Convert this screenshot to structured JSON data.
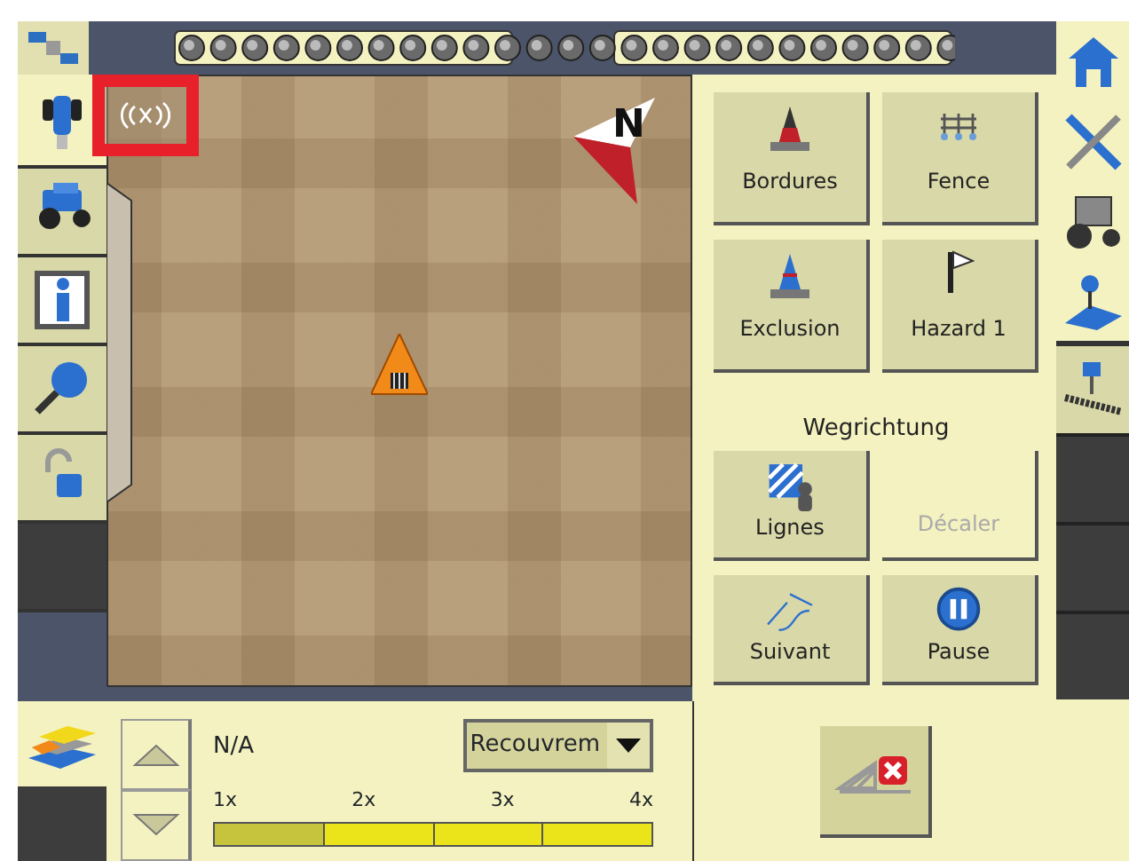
{
  "left_tabs": [
    {
      "kind": "tractor-front",
      "selected": true
    },
    {
      "kind": "tractor",
      "selected": false
    },
    {
      "kind": "info",
      "selected": false
    },
    {
      "kind": "search",
      "selected": false
    },
    {
      "kind": "lock",
      "selected": false
    },
    {
      "kind": "empty",
      "selected": false
    }
  ],
  "map": {
    "compass_label": "N"
  },
  "marking_buttons": [
    {
      "label": "Bordures",
      "kind": "cone-red",
      "disabled": false
    },
    {
      "label": "Fence",
      "kind": "fence",
      "disabled": false
    },
    {
      "label": "Exclusion",
      "kind": "cone-blue",
      "disabled": false
    },
    {
      "label": "Hazard 1",
      "kind": "flag",
      "disabled": false
    }
  ],
  "guidance": {
    "title": "Wegrichtung",
    "buttons": [
      {
        "label": "Lignes",
        "kind": "lines",
        "disabled": false
      },
      {
        "label": "Décaler",
        "kind": "none",
        "disabled": true
      },
      {
        "label": "Suivant",
        "kind": "curves",
        "disabled": false
      },
      {
        "label": "Pause",
        "kind": "pause",
        "disabled": false
      }
    ]
  },
  "right_tabs": [
    {
      "kind": "home"
    },
    {
      "kind": "tools"
    },
    {
      "kind": "tractor"
    },
    {
      "kind": "ab-line"
    },
    {
      "kind": "implement"
    },
    {
      "kind": "empty"
    },
    {
      "kind": "empty"
    },
    {
      "kind": "empty"
    }
  ],
  "coverage": {
    "value": "N/A",
    "dropdown": "Recouvrem",
    "scale_labels": [
      "1x",
      "2x",
      "3x",
      "4x"
    ],
    "segments": [
      {
        "selected": true
      },
      {
        "selected": false
      },
      {
        "selected": false
      },
      {
        "selected": false
      }
    ]
  }
}
